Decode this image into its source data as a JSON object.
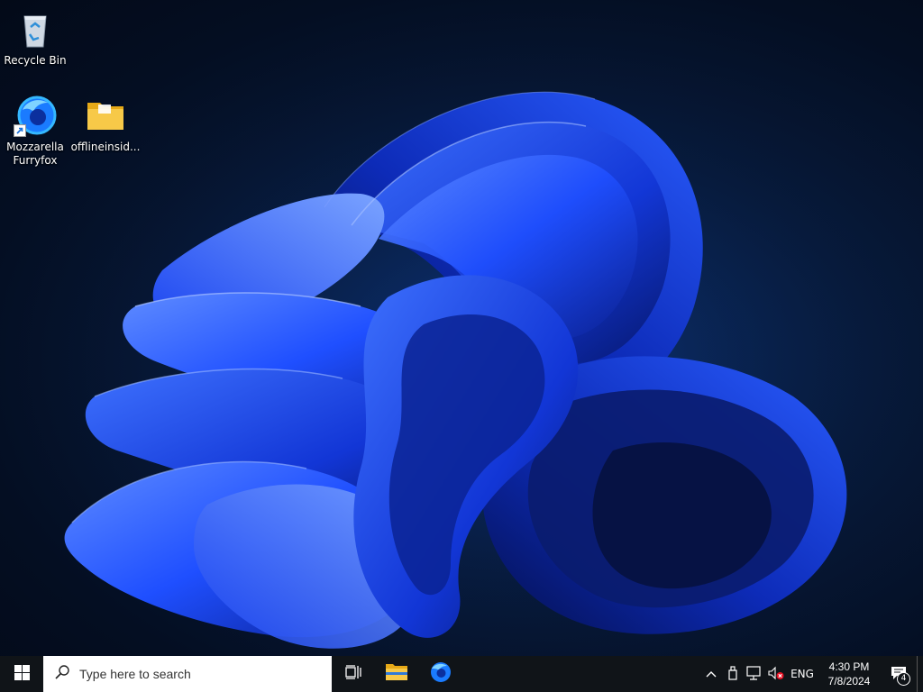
{
  "desktop": {
    "icons": [
      {
        "label": "Recycle Bin",
        "icon": "recycle-bin-icon"
      },
      {
        "label": "Mozzarella Furryfox",
        "icon": "browser-fox-icon",
        "shortcut": true
      },
      {
        "label": "offlineinsid...",
        "icon": "folder-icon"
      }
    ]
  },
  "taskbar": {
    "start_icon": "windows-logo-icon",
    "search": {
      "placeholder": "Type here to search",
      "icon": "search-icon"
    },
    "pinned": [
      {
        "name": "task-view",
        "icon": "task-view-icon"
      },
      {
        "name": "file-explorer",
        "icon": "folder-icon"
      },
      {
        "name": "mozzarella-furryfox",
        "icon": "browser-fox-icon"
      }
    ]
  },
  "tray": {
    "language": "ENG",
    "time": "4:30 PM",
    "date": "7/8/2024",
    "notification_count": "4",
    "icons": [
      "chevron-up-icon",
      "usb-device-icon",
      "network-icon",
      "volume-muted-icon"
    ]
  },
  "colors": {
    "taskbar": "#101418",
    "wallpaper_bg": "#040e22",
    "bloom_blue": "#1f4fff",
    "folder_yellow": "#f7c948"
  }
}
